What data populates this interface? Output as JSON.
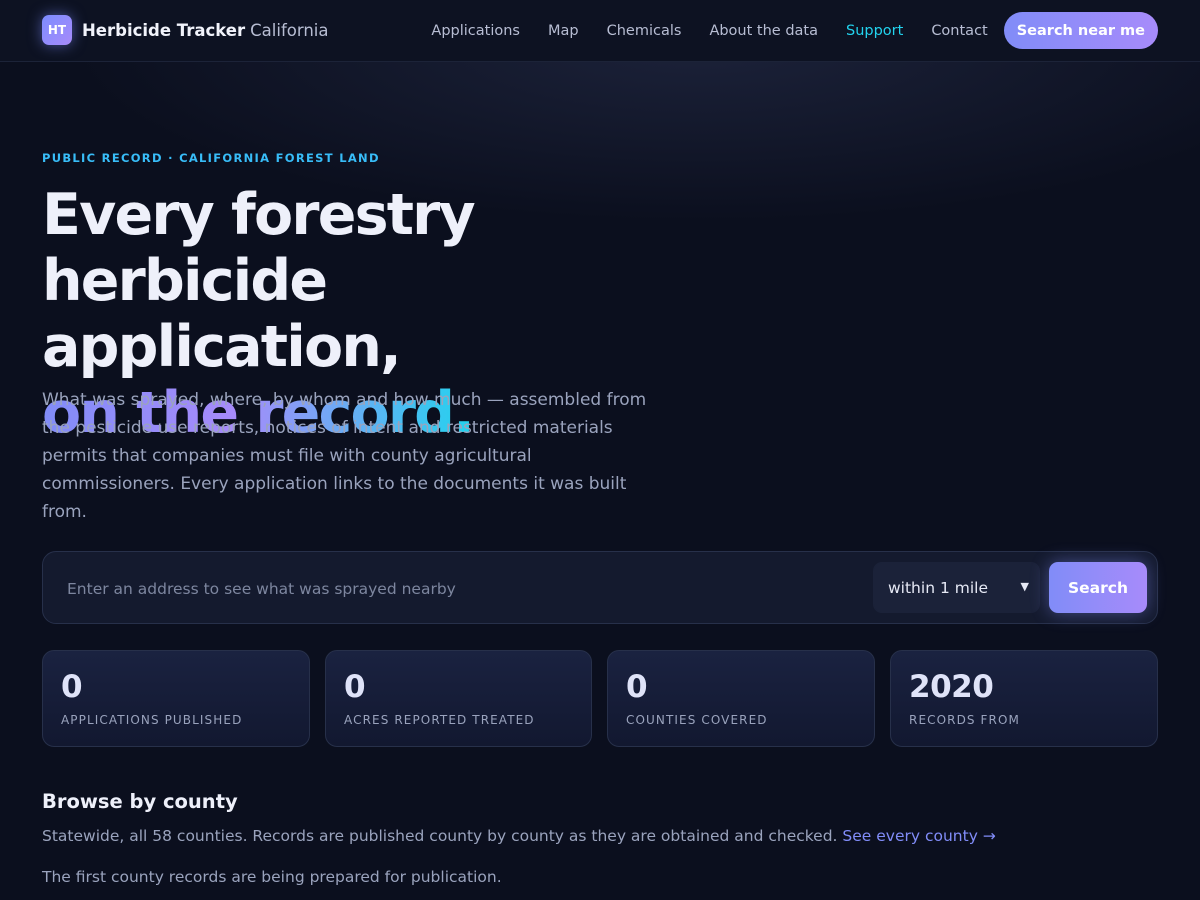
{
  "header": {
    "badge": "HT",
    "brand_name": "Herbicide Tracker",
    "brand_region": "California",
    "nav": [
      {
        "label": "Applications"
      },
      {
        "label": "Map"
      },
      {
        "label": "Chemicals"
      },
      {
        "label": "About the data"
      },
      {
        "label": "Support",
        "active": true
      },
      {
        "label": "Contact"
      }
    ],
    "cta_label": "Search near me"
  },
  "hero": {
    "eyebrow": "PUBLIC RECORD · CALIFORNIA FOREST LAND",
    "headline_line1": "Every forestry",
    "headline_line2": "herbicide application,",
    "headline_accent": "on the record.",
    "lede": "What was sprayed, where, by whom and how much — assembled from the pesticide use reports, notices of intent and restricted materials permits that companies must file with county agricultural commissioners. Every application links to the documents it was built from."
  },
  "search": {
    "placeholder": "Enter an address to see what was sprayed nearby",
    "value": "",
    "radius_selected": "within 1 mile",
    "button_label": "Search"
  },
  "stats": [
    {
      "value": "0",
      "label": "APPLICATIONS PUBLISHED"
    },
    {
      "value": "0",
      "label": "ACRES REPORTED TREATED"
    },
    {
      "value": "0",
      "label": "COUNTIES COVERED"
    },
    {
      "value": "2020",
      "label": "RECORDS FROM"
    }
  ],
  "browse": {
    "title": "Browse by county",
    "description": "Statewide, all 58 counties. Records are published county by county as they are obtained and checked.",
    "link_label": "See every county →",
    "note": "The first county records are being prepared for publication."
  },
  "colors": {
    "background": "#0b0f1e",
    "accent_indigo": "#818cf8",
    "accent_violet": "#a78bfa",
    "accent_cyan": "#22d3ee"
  },
  "icons": {
    "radius_dropdown": "chevron-down-icon",
    "link_arrow": "arrow-right-icon"
  }
}
